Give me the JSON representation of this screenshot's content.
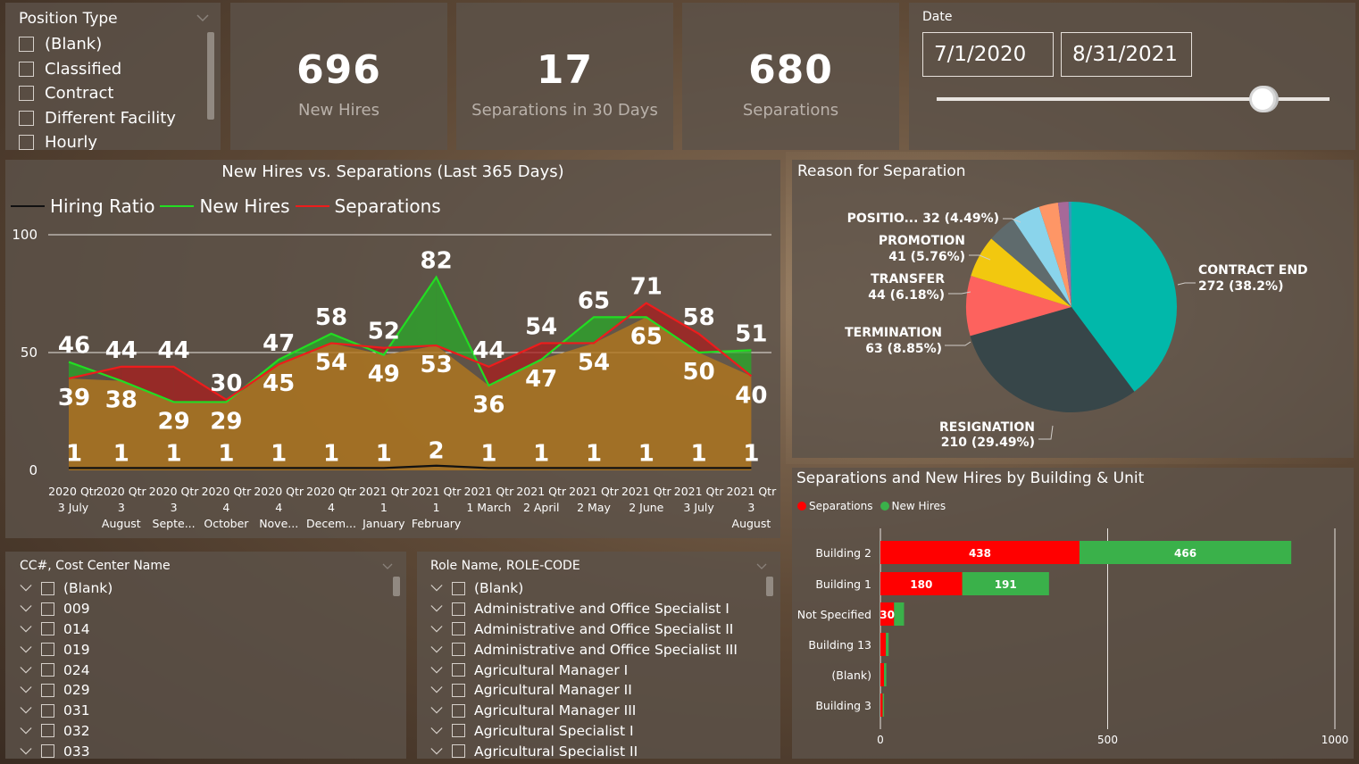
{
  "position_slicer": {
    "title": "Position Type",
    "items": [
      "(Blank)",
      "Classified",
      "Contract",
      "Different Facility",
      "Hourly"
    ]
  },
  "cards": [
    {
      "value": "696",
      "label": "New Hires"
    },
    {
      "value": "17",
      "label": "Separations in 30 Days"
    },
    {
      "value": "680",
      "label": "Separations"
    }
  ],
  "date_slicer": {
    "label": "Date",
    "start": "7/1/2020",
    "end": "8/31/2021",
    "handle_position": 0.83
  },
  "line_chart": {
    "title": "New Hires vs. Separations (Last 365 Days)",
    "legend": [
      {
        "name": "Hiring Ratio",
        "color": "#111111"
      },
      {
        "name": "New Hires",
        "color": "#22dd22"
      },
      {
        "name": "Separations",
        "color": "#ee1c1c"
      }
    ],
    "y_ticks": [
      "0",
      "50",
      "100"
    ]
  },
  "chart_data": [
    {
      "type": "line",
      "title": "New Hires vs. Separations (Last 365 Days)",
      "categories": [
        [
          "2020 Qtr",
          "3 July"
        ],
        [
          "2020 Qtr",
          "3",
          "August"
        ],
        [
          "2020 Qtr",
          "3",
          "Septe..."
        ],
        [
          "2020 Qtr",
          "4",
          "October"
        ],
        [
          "2020 Qtr",
          "4",
          "Nove..."
        ],
        [
          "2020 Qtr",
          "4",
          "Decem..."
        ],
        [
          "2021 Qtr",
          "1",
          "January"
        ],
        [
          "2021 Qtr",
          "1",
          "February"
        ],
        [
          "2021 Qtr",
          "1 March"
        ],
        [
          "2021 Qtr",
          "2 April"
        ],
        [
          "2021 Qtr",
          "2 May"
        ],
        [
          "2021 Qtr",
          "2 June"
        ],
        [
          "2021 Qtr",
          "3 July"
        ],
        [
          "2021 Qtr",
          "3",
          "August"
        ]
      ],
      "series": [
        {
          "name": "New Hires",
          "color": "#22dd22",
          "values": [
            46,
            38,
            29,
            29,
            47,
            58,
            49,
            82,
            36,
            47,
            65,
            65,
            50,
            51
          ]
        },
        {
          "name": "Separations",
          "color": "#ee1c1c",
          "values": [
            39,
            44,
            44,
            30,
            45,
            54,
            52,
            53,
            44,
            54,
            54,
            71,
            58,
            40
          ]
        },
        {
          "name": "Hiring Ratio",
          "color": "#111111",
          "values": [
            1,
            1,
            1,
            1,
            1,
            1,
            1,
            2,
            1,
            1,
            1,
            1,
            1,
            1
          ]
        }
      ],
      "ylim": [
        0,
        100
      ]
    },
    {
      "type": "pie",
      "title": "Reason for Separation",
      "slices": [
        {
          "label": "CONTRACT END",
          "value": 272,
          "pct": "38.2%",
          "color": "#01b8aa"
        },
        {
          "label": "RESIGNATION",
          "value": 210,
          "pct": "29.49%",
          "color": "#374649"
        },
        {
          "label": "TERMINATION",
          "value": 63,
          "pct": "8.85%",
          "color": "#fd625e"
        },
        {
          "label": "TRANSFER",
          "value": 44,
          "pct": "6.18%",
          "color": "#f2c80f"
        },
        {
          "label": "",
          "value": 30,
          "pct": "",
          "color": "#5f6b6d"
        },
        {
          "label": "",
          "value": 30,
          "pct": "",
          "color": "#8ad4eb"
        },
        {
          "label": "",
          "value": 20,
          "pct": "",
          "color": "#fe9666"
        },
        {
          "label": "",
          "value": 11,
          "pct": "",
          "color": "#a66999"
        },
        {
          "label": "",
          "value": 3,
          "pct": "",
          "color": "#3599b8"
        }
      ],
      "callouts": [
        {
          "name": "POSITIO...",
          "text": "32 (4.49%)"
        },
        {
          "name": "PROMOTION",
          "text": "41 (5.76%)"
        },
        {
          "name": "TRANSFER",
          "text": "44 (6.18%)"
        },
        {
          "name": "TERMINATION",
          "text": "63 (8.85%)"
        },
        {
          "name": "RESIGNATION",
          "text": "210 (29.49%)"
        },
        {
          "name": "CONTRACT END",
          "text": "272 (38.2%)"
        }
      ]
    },
    {
      "type": "bar",
      "title": "Separations and New Hires by Building & Unit",
      "categories": [
        "Building 2",
        "Building 1",
        "Not Specified",
        "Building 13",
        "(Blank)",
        "Building 3"
      ],
      "series": [
        {
          "name": "Separations",
          "color": "#ff0000",
          "values": [
            438,
            180,
            30,
            12,
            8,
            5
          ]
        },
        {
          "name": "New Hires",
          "color": "#3ab14a",
          "values": [
            466,
            191,
            22,
            6,
            5,
            3
          ]
        }
      ],
      "data_labels": {
        "Separations": [
          "438",
          "180",
          "30",
          "",
          "",
          ""
        ],
        "New Hires": [
          "466",
          "191",
          "",
          "",
          "",
          ""
        ]
      },
      "x_ticks": [
        "0",
        "500",
        "1000"
      ],
      "xlim": [
        0,
        1000
      ]
    }
  ],
  "cc_slicer": {
    "title": "CC#, Cost Center Name",
    "items": [
      "(Blank)",
      "009",
      "014",
      "019",
      "024",
      "029",
      "031",
      "032",
      "033"
    ]
  },
  "role_slicer": {
    "title": "Role Name, ROLE-CODE",
    "items": [
      "(Blank)",
      "Administrative and Office Specialist I",
      "Administrative and Office Specialist II",
      "Administrative and Office Specialist III",
      "Agricultural Manager I",
      "Agricultural Manager II",
      "Agricultural Manager III",
      "Agricultural Specialist I",
      "Agricultural Specialist II"
    ]
  }
}
